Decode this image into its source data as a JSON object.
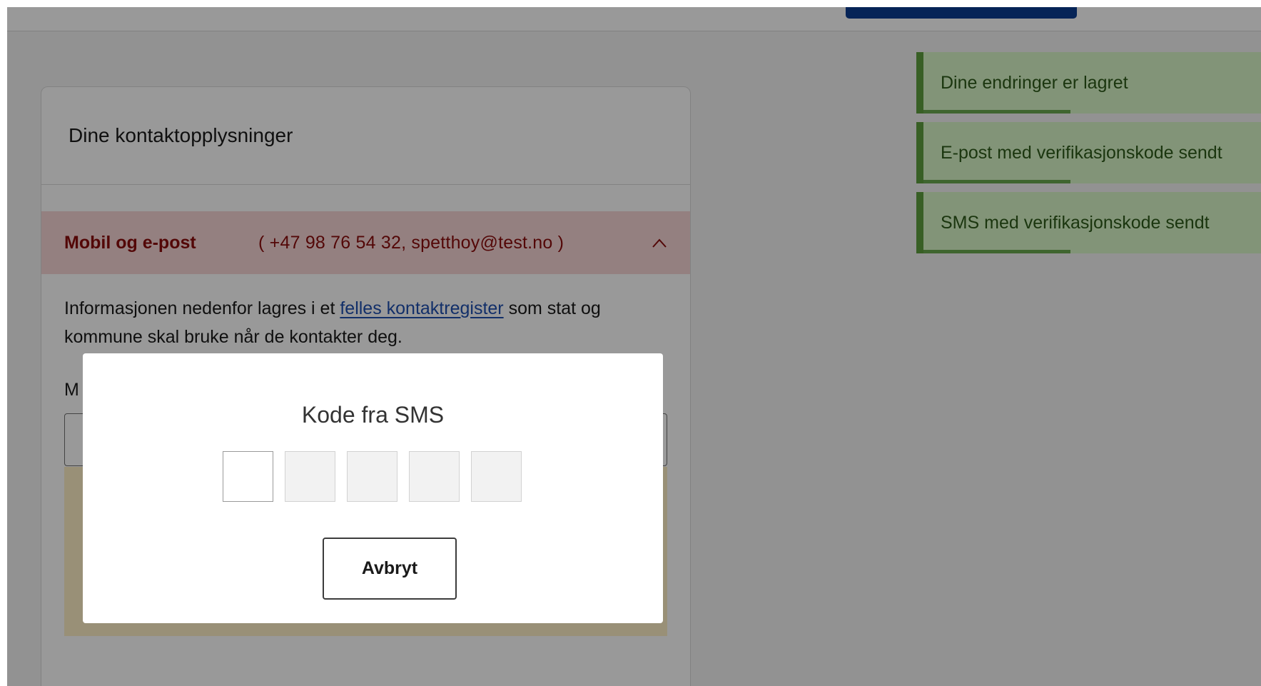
{
  "card": {
    "title": "Dine kontaktopplysninger",
    "section": {
      "title": "Mobil og e-post",
      "summary": "( +47 98 76 54 32, spetthoy@test.no )",
      "info_before_link": "Informasjonen nedenfor lagres i et ",
      "info_link": "felles kontaktregister",
      "info_after_link": " som stat og kommune skal bruke når de kontakter deg.",
      "field_label_partial": "M"
    }
  },
  "toasts": [
    {
      "text": "Dine endringer er lagret"
    },
    {
      "text": "E-post med verifikasjonskode sendt"
    },
    {
      "text": "SMS med verifikasjonskode sendt"
    }
  ],
  "modal": {
    "title": "Kode fra SMS",
    "code_digits": [
      "",
      "",
      "",
      "",
      ""
    ],
    "cancel_label": "Avbryt"
  },
  "colors": {
    "toast_bg": "#d9f7c8",
    "toast_accent": "#5e9e3e",
    "section_header_bg": "#f7d6d6",
    "section_header_text": "#8b0d0d",
    "link": "#1f4fb0",
    "header_button": "#0b3d91"
  }
}
